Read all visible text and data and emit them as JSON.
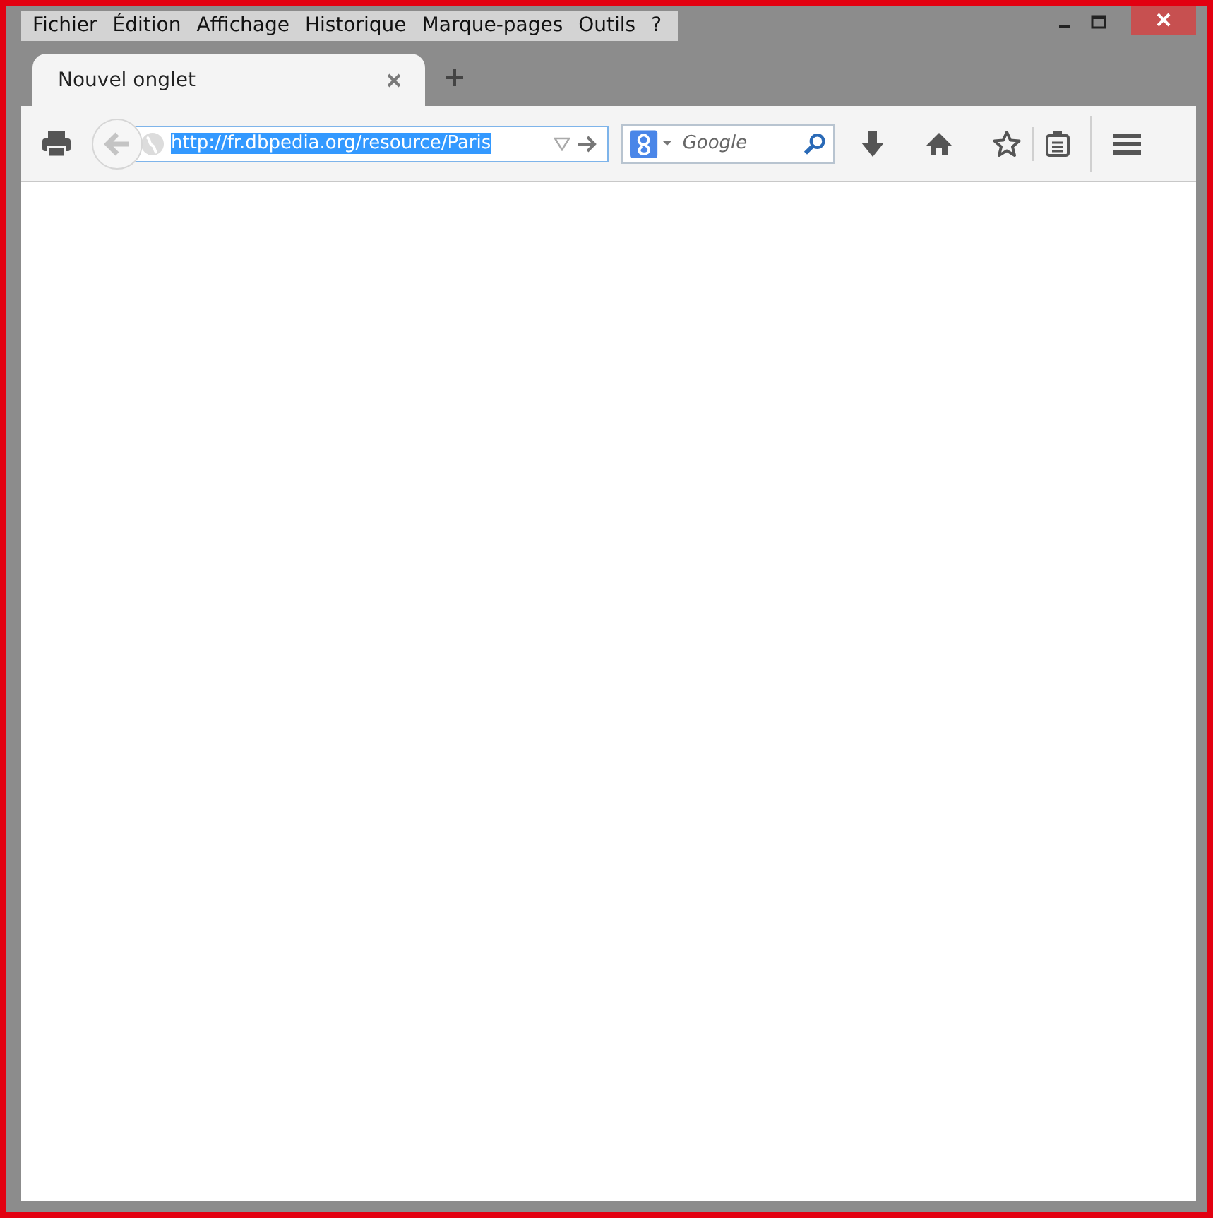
{
  "menu_bar": [
    {
      "label": "Fichier"
    },
    {
      "label": "Édition"
    },
    {
      "label": "Affichage"
    },
    {
      "label": "Historique"
    },
    {
      "label": "Marque-pages"
    },
    {
      "label": "Outils"
    },
    {
      "label": "?"
    }
  ],
  "tabs": [
    {
      "label": "Nouvel onglet",
      "selected": true
    }
  ],
  "address_bar": {
    "value": "http://fr.dbpedia.org/resource/Paris",
    "text_selected": true
  },
  "search": {
    "placeholder": "Google"
  }
}
